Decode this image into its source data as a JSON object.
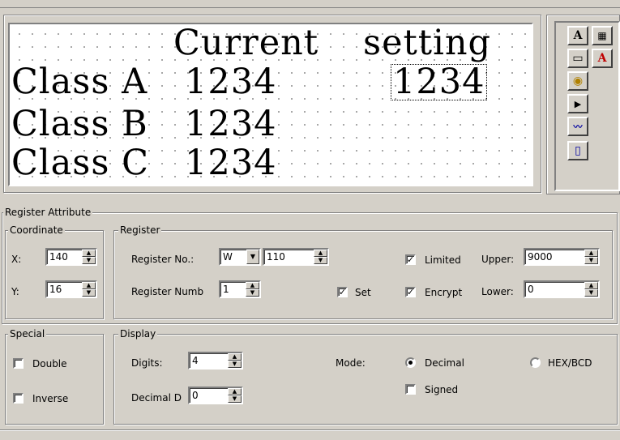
{
  "lcd": {
    "line1_label": "Current",
    "line1_value": "setting",
    "rows": [
      {
        "label": "Class A",
        "value": "1234"
      },
      {
        "label": "Class B",
        "value": "1234"
      },
      {
        "label": "Class C",
        "value": "1234"
      }
    ],
    "selected_value": "1234"
  },
  "toolbox": {
    "buttons": [
      {
        "name": "text-tool-icon",
        "glyph": "A"
      },
      {
        "name": "bitmap-tool-icon",
        "glyph": "▦"
      },
      {
        "name": "numeric-display-tool-icon",
        "glyph": "▭"
      },
      {
        "name": "ascii-input-tool-icon",
        "glyph": "A"
      },
      {
        "name": "lamp-tool-icon",
        "glyph": "◉"
      },
      {
        "name": "button-tool-icon",
        "glyph": "▶"
      },
      {
        "name": "trend-graph-tool-icon",
        "glyph": "〰"
      },
      {
        "name": "bar-graph-tool-icon",
        "glyph": "▯"
      }
    ]
  },
  "register_attribute": {
    "title": "Register Attribute",
    "coordinate": {
      "title": "Coordinate",
      "x_label": "X:",
      "x_value": "140",
      "y_label": "Y:",
      "y_value": "16"
    },
    "register": {
      "title": "Register",
      "register_no_label": "Register No.:",
      "register_type": "W",
      "register_no_value": "110",
      "register_number_label": "Register Numb",
      "register_number_value": "1",
      "set_label": "Set",
      "set_checked": true,
      "limited_label": "Limited",
      "limited_checked": true,
      "encrypt_label": "Encrypt",
      "encrypt_checked": true,
      "upper_label": "Upper:",
      "upper_value": "9000",
      "lower_label": "Lower:",
      "lower_value": "0"
    }
  },
  "special": {
    "title": "Special",
    "double_label": "Double",
    "double_checked": false,
    "inverse_label": "Inverse",
    "inverse_checked": false
  },
  "display": {
    "title": "Display",
    "digits_label": "Digits:",
    "digits_value": "4",
    "decimal_digits_label": "Decimal D",
    "decimal_digits_value": "0",
    "mode_label": "Mode:",
    "mode_decimal_label": "Decimal",
    "mode_hex_label": "HEX/BCD",
    "mode_selected": "Decimal",
    "signed_label": "Signed",
    "signed_checked": false
  }
}
